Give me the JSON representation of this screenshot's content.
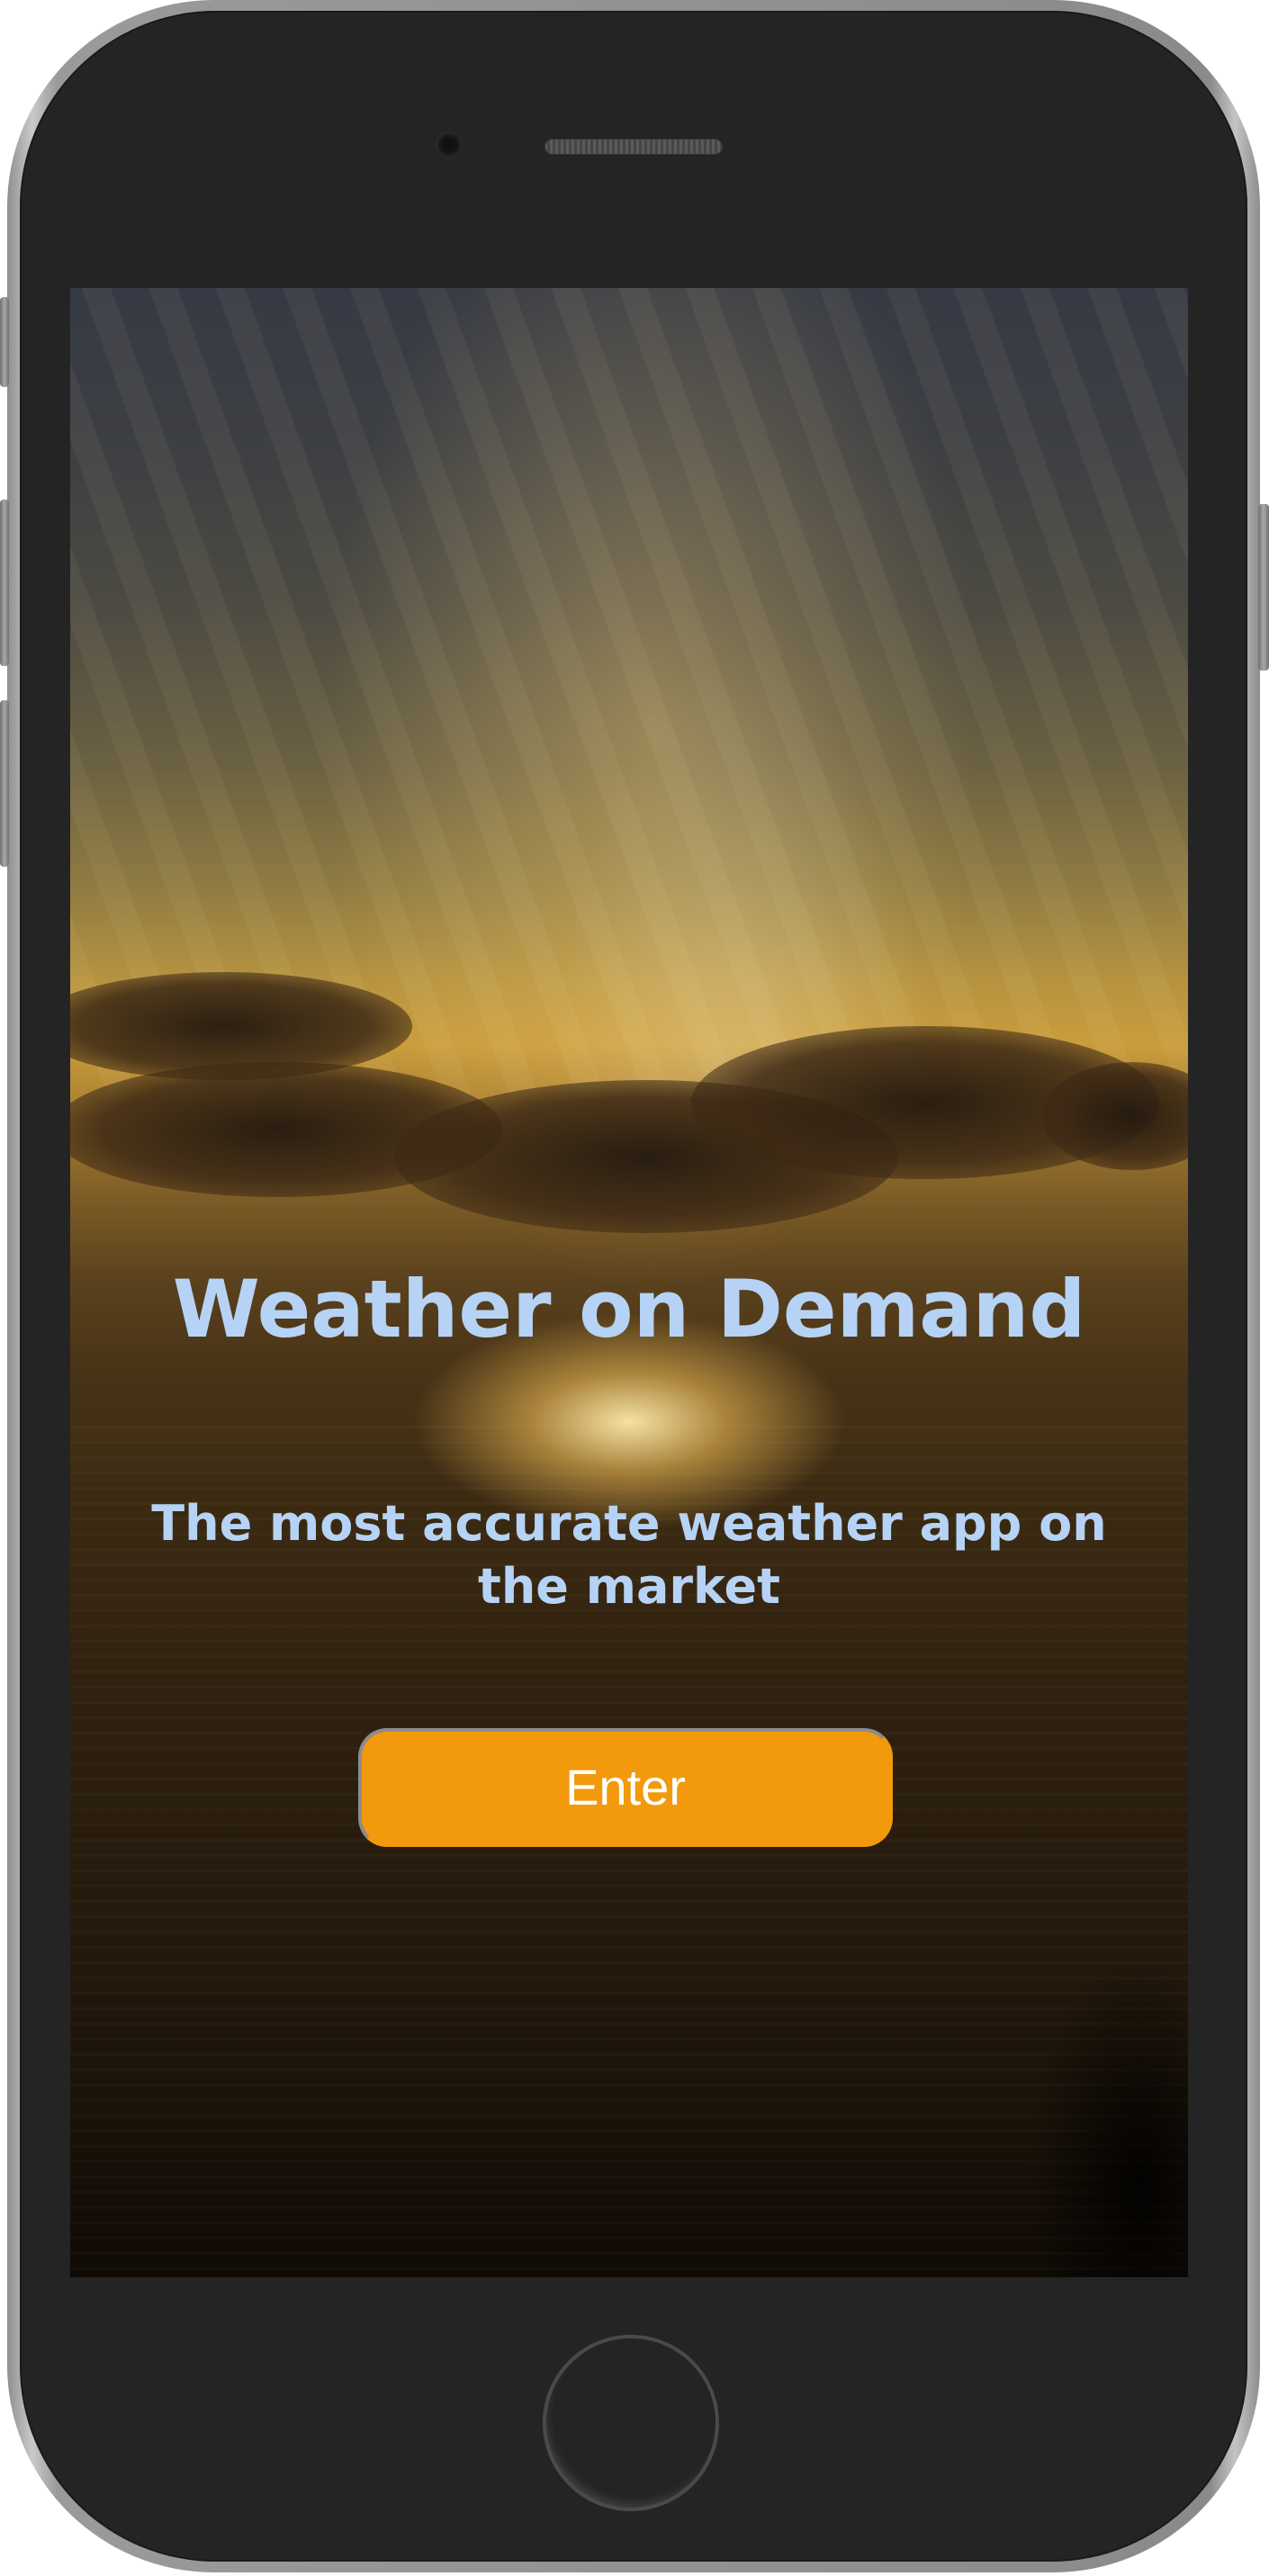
{
  "app": {
    "title": "Weather on Demand",
    "subtitle": "The most accurate weather app on the market",
    "enter_label": "Enter"
  },
  "colors": {
    "title_text": "#b6d3f5",
    "button_bg": "#f29a0c",
    "button_text": "#ffffff",
    "phone_body": "#242424"
  },
  "icons": {
    "camera": "front-camera-icon",
    "speaker": "earpiece-speaker-icon",
    "home": "home-button-icon"
  }
}
